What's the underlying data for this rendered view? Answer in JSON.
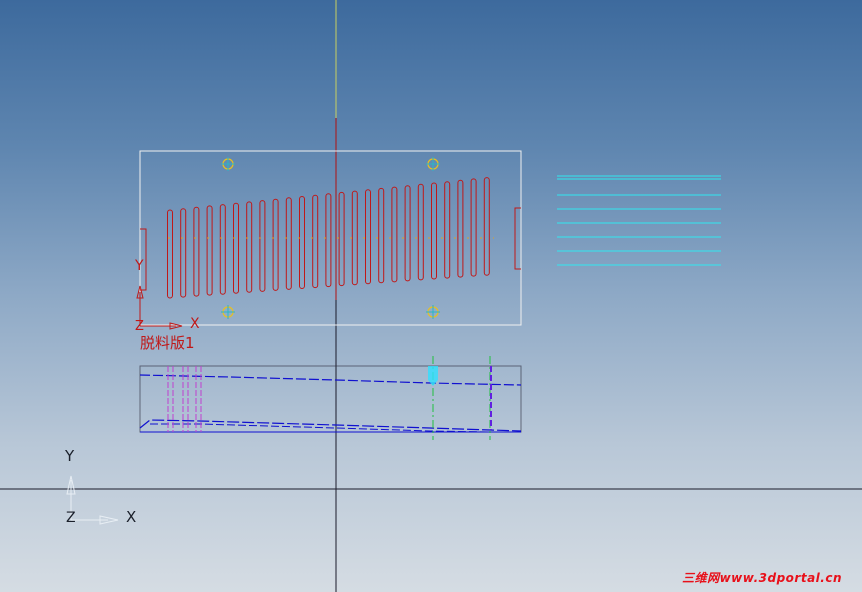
{
  "viewport": {
    "background_top": "#3d6a9d",
    "background_bottom": "#d5dce3"
  },
  "top_view": {
    "part_name": "脱料版1",
    "triad_x_label": "X",
    "triad_y_label": "Y",
    "triad_z_label": "Z",
    "outline_color": "#f0f0f0",
    "slot_color": "#c01818",
    "slot_count": 25,
    "hole_color": "#e8c020",
    "hole_center_color": "#29b7c7"
  },
  "side_view": {
    "edge_color": "#1010d0",
    "pin_color": "#c040d0",
    "green_line_color": "#20c040",
    "purple_line_color": "#6020e0",
    "marker_color": "#30e0ff"
  },
  "right_view": {
    "line_color": "#30e8f0",
    "line_count": 8
  },
  "global_triad": {
    "x_label": "X",
    "y_label": "Y",
    "z_label": "Z"
  },
  "axes": {
    "vertical_top_color": "#c8d060",
    "vertical_mid_color": "#b01010",
    "line_color": "#1a1a2a"
  },
  "watermark": "三维网www.3dportal.cn"
}
